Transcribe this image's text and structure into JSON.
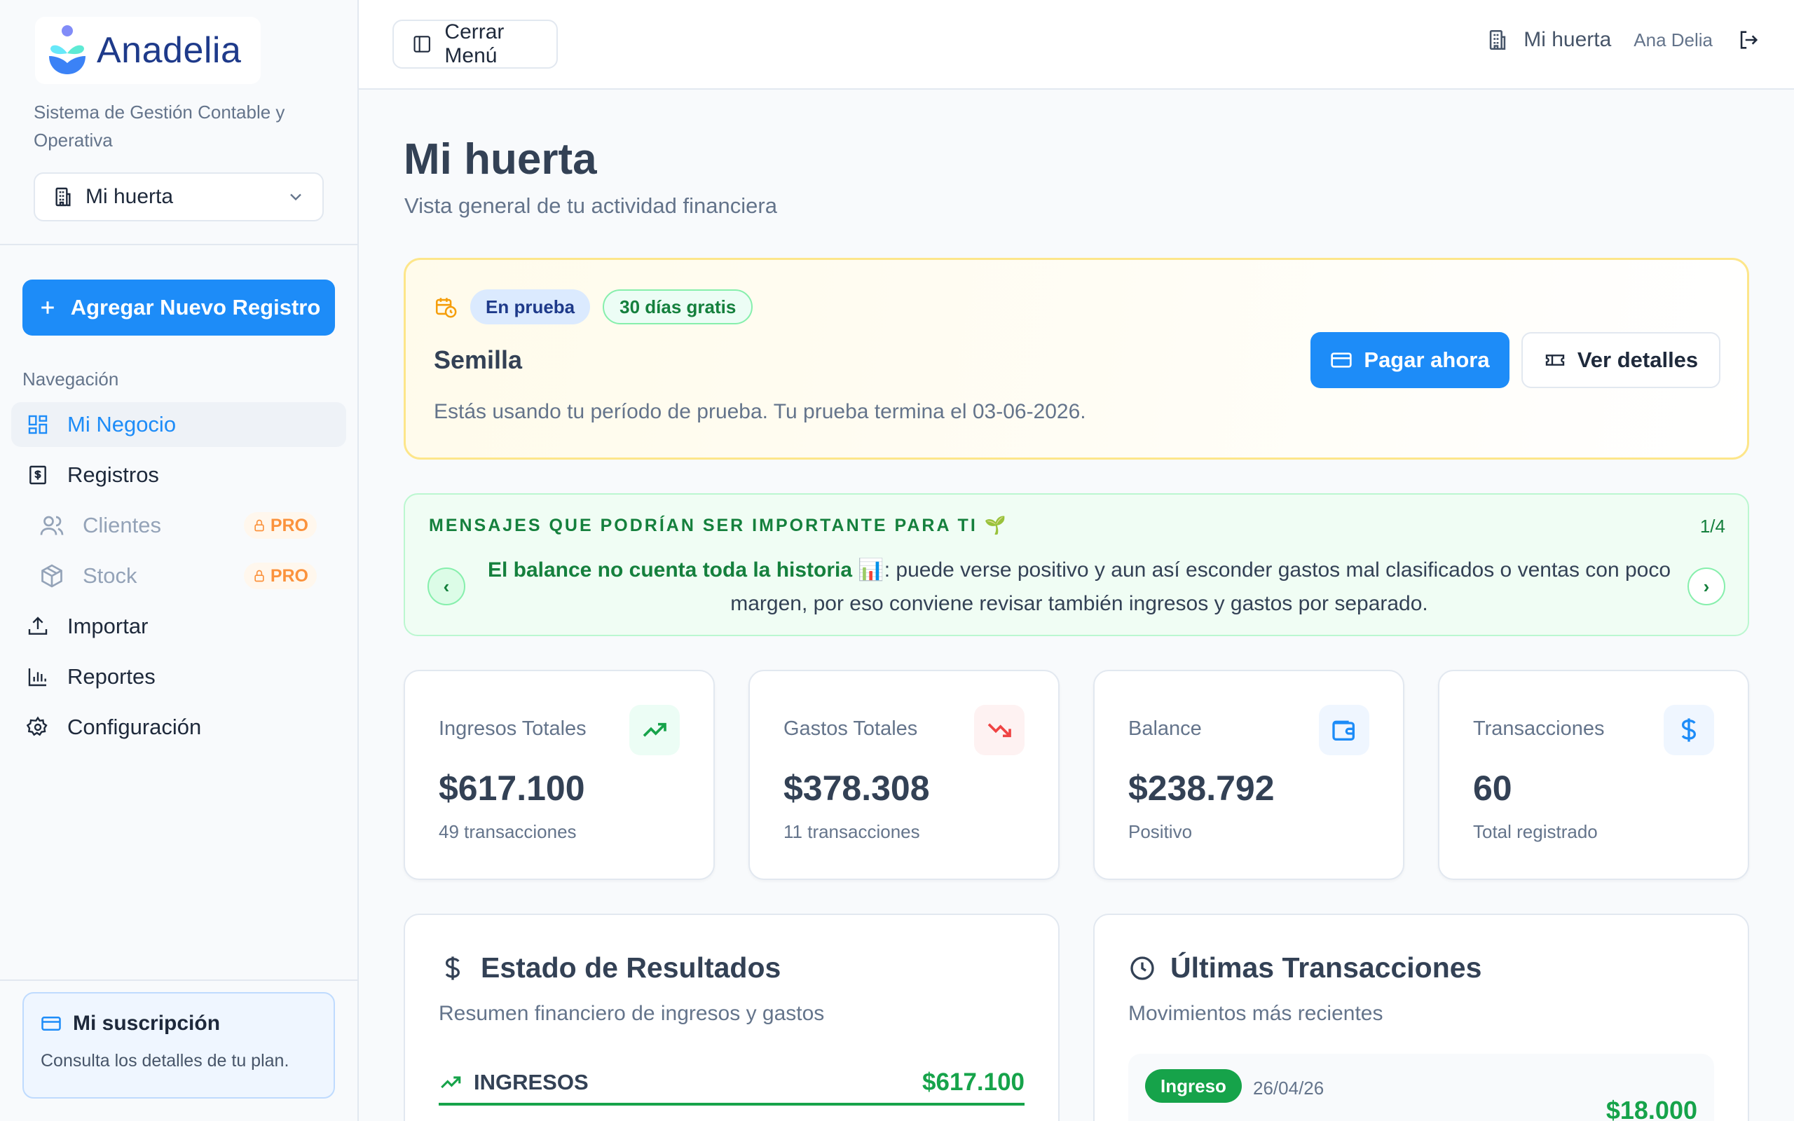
{
  "sidebar": {
    "brand": "Anadelia",
    "tagline": "Sistema de Gestión Contable y Operativa",
    "org_selected": "Mi huerta",
    "add_button": "Agregar Nuevo Registro",
    "nav_label": "Navegación",
    "items": [
      {
        "label": "Mi Negocio",
        "icon": "dashboard-icon",
        "active": true
      },
      {
        "label": "Registros",
        "icon": "receipt-icon"
      },
      {
        "label": "Clientes",
        "icon": "users-icon",
        "badge": "PRO"
      },
      {
        "label": "Stock",
        "icon": "box-icon",
        "badge": "PRO"
      },
      {
        "label": "Importar",
        "icon": "upload-icon"
      },
      {
        "label": "Reportes",
        "icon": "bar-chart-icon"
      },
      {
        "label": "Configuración",
        "icon": "gear-icon"
      }
    ],
    "subscription": {
      "title": "Mi suscripción",
      "desc": "Consulta los detalles de tu plan."
    }
  },
  "topbar": {
    "close_menu": "Cerrar Menú",
    "org": "Mi huerta",
    "user": "Ana Delia"
  },
  "header": {
    "title": "Mi huerta",
    "subtitle": "Vista general de tu actividad financiera"
  },
  "trial": {
    "badge_status": "En prueba",
    "badge_days": "30 días gratis",
    "plan": "Semilla",
    "message": "Estás usando tu período de prueba. Tu prueba termina el 03-06-2026.",
    "pay_button": "Pagar ahora",
    "details_button": "Ver detalles"
  },
  "tips": {
    "heading": "MENSAJES QUE PODRÍAN SER IMPORTANTE PARA TI 🌱",
    "counter": "1/4",
    "highlight": "El balance no cuenta toda la historia 📊",
    "body": ": puede verse positivo y aun así esconder gastos mal clasificados o ventas con poco margen, por eso conviene revisar también ingresos y gastos por separado."
  },
  "stats": [
    {
      "label": "Ingresos Totales",
      "value": "$617.100",
      "sub": "49 transacciones",
      "icon": "trending-up-icon",
      "color": "#16a34a",
      "bg": "#ecfdf5"
    },
    {
      "label": "Gastos Totales",
      "value": "$378.308",
      "sub": "11 transacciones",
      "icon": "trending-down-icon",
      "color": "#ef4444",
      "bg": "#fef2f2"
    },
    {
      "label": "Balance",
      "value": "$238.792",
      "sub": "Positivo",
      "icon": "wallet-icon",
      "color": "#1d8cf8",
      "bg": "#eff6ff"
    },
    {
      "label": "Transacciones",
      "value": "60",
      "sub": "Total registrado",
      "icon": "dollar-icon",
      "color": "#1d8cf8",
      "bg": "#eff6ff"
    }
  ],
  "results": {
    "title": "Estado de Resultados",
    "subtitle": "Resumen financiero de ingresos y gastos",
    "income_label": "INGRESOS",
    "income_value": "$617.100"
  },
  "latest": {
    "title": "Últimas Transacciones",
    "subtitle": "Movimientos más recientes",
    "first": {
      "tag": "Ingreso",
      "date": "26/04/26",
      "amount": "$18.000"
    }
  },
  "colors": {
    "accent": "#1d8cf8",
    "success": "#16a34a",
    "danger": "#ef4444",
    "warning": "#fb923c"
  }
}
